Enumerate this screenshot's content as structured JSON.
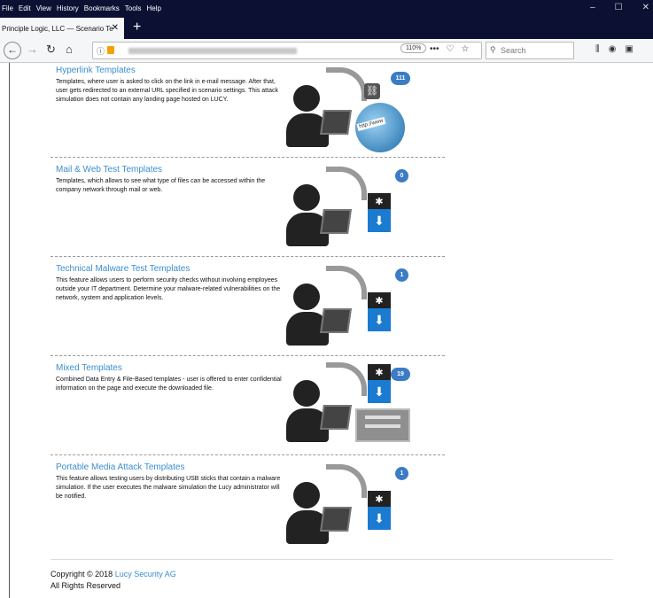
{
  "menubar": {
    "items": [
      "File",
      "Edit",
      "View",
      "History",
      "Bookmarks",
      "Tools",
      "Help"
    ]
  },
  "window": {
    "minimize": "–",
    "maximize": "☐",
    "close": "✕"
  },
  "tab": {
    "title": "Principle Logic, LLC — Scenario Te",
    "close": "✕",
    "new_tab": "+"
  },
  "navbar": {
    "zoom": "110%",
    "search_placeholder": "Search",
    "page_actions": "•••"
  },
  "sections": [
    {
      "title": "Hyperlink Templates",
      "description": "Templates, where user is asked to click on the link in e-mail message. After that, user gets redirected to an external URL specified in scenario settings. This attack simulation does not contain any landing page hosted on LUCY.",
      "count": "111",
      "illustration": "hyperlink",
      "globe_text": "http://www"
    },
    {
      "title": "Mail & Web Test Templates",
      "description": "Templates, which allows to see what type of files can be accessed within the company network through mail or web.",
      "count": "0",
      "illustration": "download"
    },
    {
      "title": "Technical Malware Test Templates",
      "description": "This feature allows users to perform security checks without involving employees outside your IT department. Determine your malware-related vulnerabilities on the network, system and application levels.",
      "count": "1",
      "illustration": "download"
    },
    {
      "title": "Mixed Templates",
      "description": "Combined Data Entry & File-Based templates - user is offered to enter confidential information on the page and execute the downloaded file.",
      "count": "19",
      "illustration": "mixed"
    },
    {
      "title": "Portable Media Attack Templates",
      "description": "This feature allows testing users by distributing USB sticks that contain a malware simulation. If the user executes the malware simulation the Lucy administrator will be notified.",
      "count": "1",
      "illustration": "download"
    }
  ],
  "footer": {
    "copyright_prefix": "Copyright © 2018 ",
    "company": "Lucy Security AG",
    "rights": "All Rights Reserved"
  },
  "colors": {
    "accent": "#3b8ed0",
    "badge": "#3b7cc4",
    "titlebar": "#0c1133"
  }
}
